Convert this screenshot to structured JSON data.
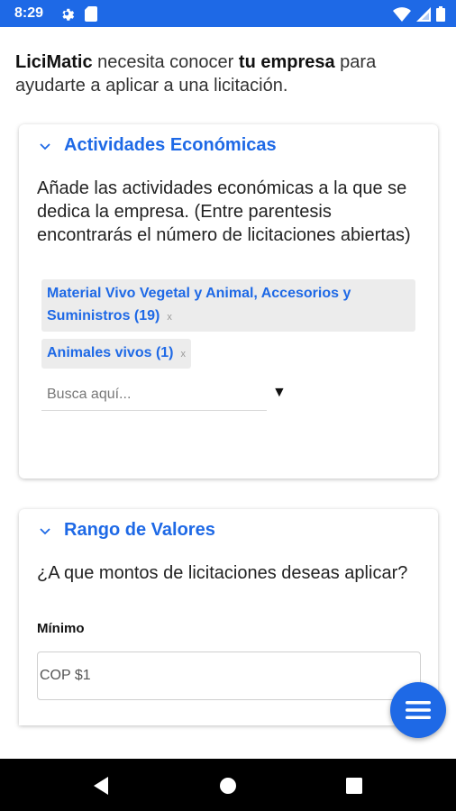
{
  "status_bar": {
    "time": "8:29",
    "icons": [
      "gear-icon",
      "sd-card-icon",
      "wifi-icon",
      "signal-icon",
      "battery-icon"
    ],
    "background": "#1e69e6"
  },
  "intro": {
    "brand": "LiciMatic",
    "text_1": " necesita conocer ",
    "emphasis": "tu empresa",
    "text_2": " para ayudarte a aplicar a una licitación."
  },
  "actividades": {
    "title": "Actividades Económicas",
    "description": "Añade las actividades económicas a la que se dedica la empresa. (Entre parentesis encontrarás el número de licitaciones abiertas)",
    "chips": [
      {
        "label": "Material Vivo Vegetal y Animal, Accesorios y Suministros (19)",
        "remove": "x"
      },
      {
        "label": "Animales vivos (1)",
        "remove": "x"
      }
    ],
    "search_placeholder": "Busca aquí...",
    "dropdown_symbol": "▼"
  },
  "rango": {
    "title": "Rango de Valores",
    "question": "¿A que montos de licitaciones deseas aplicar?",
    "min_label": "Mínimo",
    "min_value": "COP $1"
  },
  "fab": {
    "icon": "menu-icon"
  },
  "nav": {
    "icons": [
      "back-icon",
      "home-icon",
      "recents-icon"
    ]
  },
  "colors": {
    "accent": "#1e69e6",
    "chip_bg": "#ececec"
  }
}
